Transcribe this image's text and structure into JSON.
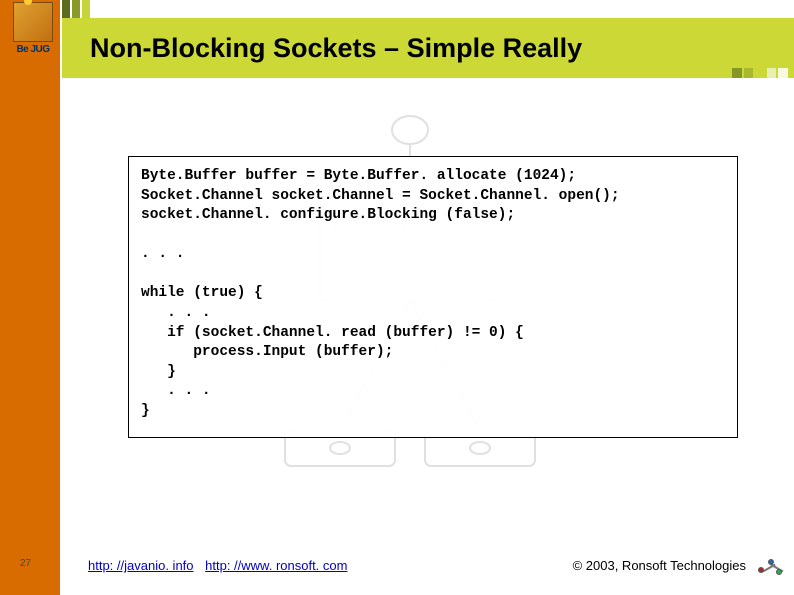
{
  "logo": {
    "caption": "Be JUG"
  },
  "header": {
    "title": "Non-Blocking Sockets – Simple Really"
  },
  "code": {
    "line1": "Byte.Buffer buffer = Byte.Buffer. allocate (1024);",
    "line2": "Socket.Channel socket.Channel = Socket.Channel. open();",
    "line3": "socket.Channel. configure.Blocking (false);",
    "blank1": "",
    "line4": ". . .",
    "blank2": "",
    "line5": "while (true) {",
    "line6": "   . . .",
    "line7": "   if (socket.Channel. read (buffer) != 0) {",
    "line8": "      process.Input (buffer);",
    "line9": "   }",
    "line10": "   . . .",
    "line11": "}"
  },
  "footer": {
    "page": "27",
    "link1": "http: //javanio. info",
    "link2": "http: //www. ronsoft. com",
    "copyright": "© 2003, Ronsoft Technologies"
  }
}
